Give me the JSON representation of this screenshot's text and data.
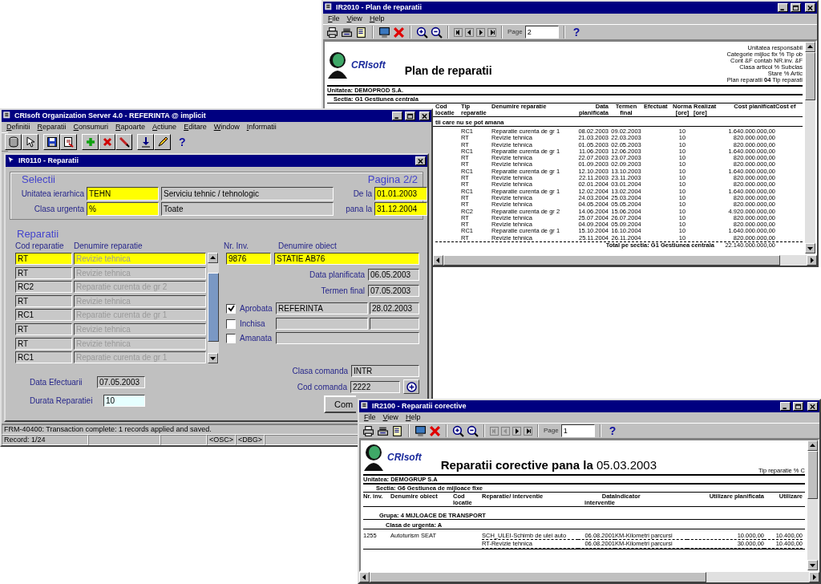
{
  "report_window": {
    "title": "IR2010 - Plan de reparatii",
    "menu": [
      "File",
      "View",
      "Help"
    ],
    "at_first_page": false,
    "page_label": "Page",
    "page": "2",
    "help": "?",
    "brand": "CRIsoft",
    "report_title": "Plan de reparatii",
    "parameters": [
      "Unitatea responsabil",
      "Categorie mijloc fix % Tip ob",
      "Cont &F contab NR.inv. &F",
      "Clasa articol % Subclas",
      "Stare % Artic",
      "Plan reparatii **04** Tip reparati"
    ],
    "unit": "Unitatea: DEMOPROD S.A.",
    "section": "Sectia: G1 Gestiunea centrala",
    "columns": [
      "Cod locatie",
      "Tip reparatie",
      "Denumire reparatie",
      "Data planificata",
      "Termen final",
      "Efectuat",
      "Norma [ore]",
      "Realizat [ore]",
      "Cost planificat",
      "Cost ef"
    ],
    "group": "tii care nu se pot amana",
    "rows": [
      {
        "tip": "RC1",
        "denumire": "Reparatie curenta de gr 1",
        "data_planificata": "08.02.2003",
        "termen_final": "09.02.2003",
        "norma": "10",
        "cost_planificat": "1.640.000.000,00"
      },
      {
        "tip": "RT",
        "denumire": "Revizie tehnica",
        "data_planificata": "21.03.2003",
        "termen_final": "22.03.2003",
        "norma": "10",
        "cost_planificat": "820.000.000,00"
      },
      {
        "tip": "RT",
        "denumire": "Revizie tehnica",
        "data_planificata": "01.05.2003",
        "termen_final": "02.05.2003",
        "norma": "10",
        "cost_planificat": "820.000.000,00"
      },
      {
        "tip": "RC1",
        "denumire": "Reparatie curenta de gr 1",
        "data_planificata": "11.06.2003",
        "termen_final": "12.06.2003",
        "norma": "10",
        "cost_planificat": "1.640.000.000,00"
      },
      {
        "tip": "RT",
        "denumire": "Revizie tehnica",
        "data_planificata": "22.07.2003",
        "termen_final": "23.07.2003",
        "norma": "10",
        "cost_planificat": "820.000.000,00"
      },
      {
        "tip": "RT",
        "denumire": "Revizie tehnica",
        "data_planificata": "01.09.2003",
        "termen_final": "02.09.2003",
        "norma": "10",
        "cost_planificat": "820.000.000,00"
      },
      {
        "tip": "RC1",
        "denumire": "Reparatie curenta de gr 1",
        "data_planificata": "12.10.2003",
        "termen_final": "13.10.2003",
        "norma": "10",
        "cost_planificat": "1.640.000.000,00"
      },
      {
        "tip": "RT",
        "denumire": "Revizie tehnica",
        "data_planificata": "22.11.2003",
        "termen_final": "23.11.2003",
        "norma": "10",
        "cost_planificat": "820.000.000,00"
      },
      {
        "tip": "RT",
        "denumire": "Revizie tehnica",
        "data_planificata": "02.01.2004",
        "termen_final": "03.01.2004",
        "norma": "10",
        "cost_planificat": "820.000.000,00"
      },
      {
        "tip": "RC1",
        "denumire": "Reparatie curenta de gr 1",
        "data_planificata": "12.02.2004",
        "termen_final": "13.02.2004",
        "norma": "10",
        "cost_planificat": "1.640.000.000,00"
      },
      {
        "tip": "RT",
        "denumire": "Revizie tehnica",
        "data_planificata": "24.03.2004",
        "termen_final": "25.03.2004",
        "norma": "10",
        "cost_planificat": "820.000.000,00"
      },
      {
        "tip": "RT",
        "denumire": "Revizie tehnica",
        "data_planificata": "04.05.2004",
        "termen_final": "05.05.2004",
        "norma": "10",
        "cost_planificat": "820.000.000,00"
      },
      {
        "tip": "RC2",
        "denumire": "Reparatie curenta de gr 2",
        "data_planificata": "14.06.2004",
        "termen_final": "15.06.2004",
        "norma": "10",
        "cost_planificat": "4.920.000.000,00"
      },
      {
        "tip": "RT",
        "denumire": "Revizie tehnica",
        "data_planificata": "25.07.2004",
        "termen_final": "26.07.2004",
        "norma": "10",
        "cost_planificat": "820.000.000,00"
      },
      {
        "tip": "RT",
        "denumire": "Revizie tehnica",
        "data_planificata": "04.09.2004",
        "termen_final": "05.09.2004",
        "norma": "10",
        "cost_planificat": "820.000.000,00"
      },
      {
        "tip": "RC1",
        "denumire": "Reparatie curenta de gr 1",
        "data_planificata": "15.10.2004",
        "termen_final": "16.10.2004",
        "norma": "10",
        "cost_planificat": "1.640.000.000,00"
      },
      {
        "tip": "RT",
        "denumire": "Revizie tehnica",
        "data_planificata": "25.11.2004",
        "termen_final": "26.11.2004",
        "norma": "10",
        "cost_planificat": "820.000.000,00"
      }
    ],
    "total_label": "Total pe sectia: G1 Gestiunea centrala",
    "total": "22.140.000.000,00"
  },
  "form_window": {
    "title": "CRIsoft Organization Server 4.0 - REFERINTA @ implicit",
    "menu": [
      "Definitii",
      "Reparatii",
      "Consumuri",
      "Rapoarte",
      "Actiune",
      "Editare",
      "Window",
      "Informatii"
    ],
    "help": "?",
    "form_title": "IR0110 - Reparatii",
    "selection_heading": "Selectii",
    "page_indicator": "Pagina 2/2",
    "filters": [
      {
        "label": "Unitatea ierarhica",
        "code": "TEHN",
        "description": "Serviciu tehnic / tehnologic",
        "range_label": "De la",
        "date": "01.01.2003"
      },
      {
        "label": "Clasa urgenta",
        "code": "%",
        "description": "Toate",
        "range_label": "pana la",
        "date": "31.12.2004"
      }
    ],
    "repairs_heading": "Reparatii",
    "repair_columns": [
      "Cod reparatie",
      "Denumire reparatie"
    ],
    "repairs": [
      {
        "code": "RT",
        "name": "Revizie tehnica",
        "selected": true
      },
      {
        "code": "RT",
        "name": "Revizie tehnica",
        "selected": false
      },
      {
        "code": "RC2",
        "name": "Reparatie curenta de gr 2",
        "selected": false
      },
      {
        "code": "RT",
        "name": "Revizie tehnica",
        "selected": false
      },
      {
        "code": "RC1",
        "name": "Reparatie curenta de gr 1",
        "selected": false
      },
      {
        "code": "RT",
        "name": "Revizie tehnica",
        "selected": false
      },
      {
        "code": "RT",
        "name": "Revizie tehnica",
        "selected": false
      },
      {
        "code": "RC1",
        "name": "Reparatie curenta de gr 1",
        "selected": false
      }
    ],
    "object_columns": [
      "Nr. Inv.",
      "Denumire obiect"
    ],
    "inventory_no": "9876",
    "object_name": "STATIE AB76",
    "dates": [
      {
        "label": "Data planificata",
        "value": "06.05.2003"
      },
      {
        "label": "Termen final",
        "value": "07.05.2003"
      }
    ],
    "approvals": [
      {
        "kind": "dated",
        "label": "Aprobata",
        "checked": true,
        "user": "REFERINTA",
        "date": "28.02.2003"
      },
      {
        "kind": "dated",
        "label": "Inchisa",
        "checked": false
      },
      {
        "kind": "note",
        "label": "Amanata",
        "checked": false
      }
    ],
    "execution_date": {
      "label": "Data Efectuarii",
      "value": "07.05.2003"
    },
    "duration": {
      "label": "Durata Reparatiei",
      "value": "10"
    },
    "order_class": {
      "label": "Clasa comanda",
      "value": "INTR"
    },
    "order_code": {
      "label": "Cod comanda",
      "value": "2222"
    },
    "action_button": "Com",
    "message": "FRM-40400: Transaction complete: 1 records applied and saved.",
    "record": "Record: 1/24",
    "indicators": [
      "<OSC>",
      "<DBG>"
    ]
  },
  "corrective_window": {
    "title": "IR2100 - Reparatii corective",
    "menu": [
      "File",
      "View",
      "Help"
    ],
    "at_first_page": true,
    "page_label": "Page",
    "page": "1",
    "help": "?",
    "brand": "CRIsoft",
    "report_title": "**Reparatii corective pana la** 05.03.2003",
    "parameters": [
      "Tip reparatie % C"
    ],
    "unit": "Unitatea: DEMOGRUP S.A",
    "section": "Sectia: G6 Gestiunea de mijloace fixe",
    "columns": [
      "Nr. inv.",
      "Denumire obiect",
      "Cod locatie",
      "Reparatie/ interventie",
      "Data interventie",
      "Indicator",
      "Utilizare planificata",
      "Utilizare"
    ],
    "group": "Grupa: 4 MIJLOACE DE TRANSPORT",
    "urgency": "Clasa de urgenta: A",
    "rows": [
      {
        "nr_inv": "1255",
        "obiect": "Autoturism SEAT",
        "interventie": "SCH_ULEI-Schimb de ulei auto",
        "data": "06.08.2001",
        "indicator": "KM-Kilometri parcursi",
        "planificat": "10.000,00",
        "utilizare": "10.400,00"
      },
      {
        "interventie": "RT-Revizie tehnica",
        "data": "06.08.2001",
        "indicator": "KM-Kilometri parcursi",
        "planificat": "30.000,00",
        "utilizare": "10.400,00"
      }
    ]
  }
}
